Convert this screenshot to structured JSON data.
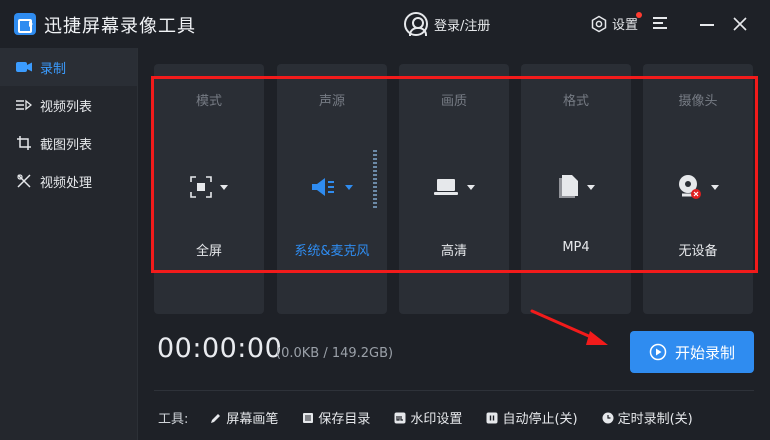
{
  "app": {
    "title": "迅捷屏幕录像工具",
    "login_label": "登录/注册",
    "settings_label": "设置",
    "accent_color": "#2f8cf0",
    "alert_color": "#ff3b30"
  },
  "sidebar": {
    "items": [
      {
        "label": "录制",
        "icon": "camera-icon",
        "active": true
      },
      {
        "label": "视频列表",
        "icon": "list-icon",
        "active": false
      },
      {
        "label": "截图列表",
        "icon": "screenshot-icon",
        "active": false
      },
      {
        "label": "视频处理",
        "icon": "tools-icon",
        "active": false
      }
    ]
  },
  "cards": [
    {
      "label": "模式",
      "value": "全屏",
      "icon": "fullscreen-icon"
    },
    {
      "label": "声源",
      "value": "系统&麦克风",
      "icon": "speaker-icon"
    },
    {
      "label": "画质",
      "value": "高清",
      "icon": "laptop-icon"
    },
    {
      "label": "格式",
      "value": "MP4",
      "icon": "file-icon"
    },
    {
      "label": "摄像头",
      "value": "无设备",
      "icon": "webcam-icon"
    }
  ],
  "recording": {
    "timer": "00:00:00",
    "size": "(0.0KB / 149.2GB)",
    "start_label": "开始录制"
  },
  "tools": {
    "label": "工具:",
    "items": [
      {
        "label": "屏幕画笔",
        "icon": "pen-icon"
      },
      {
        "label": "保存目录",
        "icon": "folder-icon"
      },
      {
        "label": "水印设置",
        "icon": "watermark-icon"
      },
      {
        "label": "自动停止(关)",
        "icon": "pause-icon"
      },
      {
        "label": "定时录制(关)",
        "icon": "clock-icon"
      }
    ]
  }
}
